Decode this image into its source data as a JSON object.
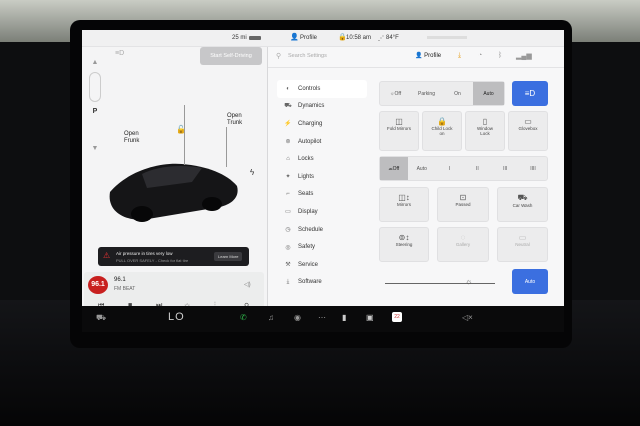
{
  "status": {
    "range": "25 mi",
    "profile": "Profile",
    "time": "10:58 am",
    "temp": "84°F"
  },
  "left": {
    "start_self_driving": "Start Self-Driving",
    "frunk_label": "Open\nFrunk",
    "trunk_label": "Open\nTrunk",
    "gear_p": "P",
    "alert_title": "Air pressure in tires very low",
    "alert_sub": "PULL OVER SAFELY - Check for flat tire",
    "alert_action": "Learn More"
  },
  "media": {
    "logo": "96.1",
    "station": "96.1",
    "source": "FM BEAT"
  },
  "settings": {
    "search_placeholder": "Search Settings",
    "profile": "Profile",
    "menu": [
      {
        "label": "Controls",
        "icon": "toggle-icon",
        "glyph": "◐"
      },
      {
        "label": "Dynamics",
        "icon": "car-icon",
        "glyph": "⛟"
      },
      {
        "label": "Charging",
        "icon": "bolt-icon",
        "glyph": "⚡"
      },
      {
        "label": "Autopilot",
        "icon": "steering-icon",
        "glyph": "⊚"
      },
      {
        "label": "Locks",
        "icon": "lock-icon",
        "glyph": "🔒"
      },
      {
        "label": "Lights",
        "icon": "light-icon",
        "glyph": "✦"
      },
      {
        "label": "Seats",
        "icon": "seat-icon",
        "glyph": "⌐"
      },
      {
        "label": "Display",
        "icon": "display-icon",
        "glyph": "▭"
      },
      {
        "label": "Schedule",
        "icon": "schedule-icon",
        "glyph": "◷"
      },
      {
        "label": "Safety",
        "icon": "safety-icon",
        "glyph": "◎"
      },
      {
        "label": "Service",
        "icon": "wrench-icon",
        "glyph": "⚒"
      },
      {
        "label": "Software",
        "icon": "download-icon",
        "glyph": "⤓"
      }
    ]
  },
  "controls": {
    "lights_seg": [
      "Off",
      "Parking",
      "On",
      "Auto"
    ],
    "tiles_row1": [
      "Fold Mirrors",
      "Child Lock\non",
      "Window\nLock",
      "Glovebox"
    ],
    "wiper_seg": [
      "Off",
      "Auto",
      "I",
      "II",
      "III",
      "IIII"
    ],
    "tiles_row2": [
      "Mirrors",
      "Passed",
      "Car Wash"
    ],
    "tiles_row3": [
      "Steering",
      "Gallery",
      "Neutral"
    ],
    "auto_btn": "Auto"
  },
  "taskbar": {
    "climate": "LO"
  }
}
